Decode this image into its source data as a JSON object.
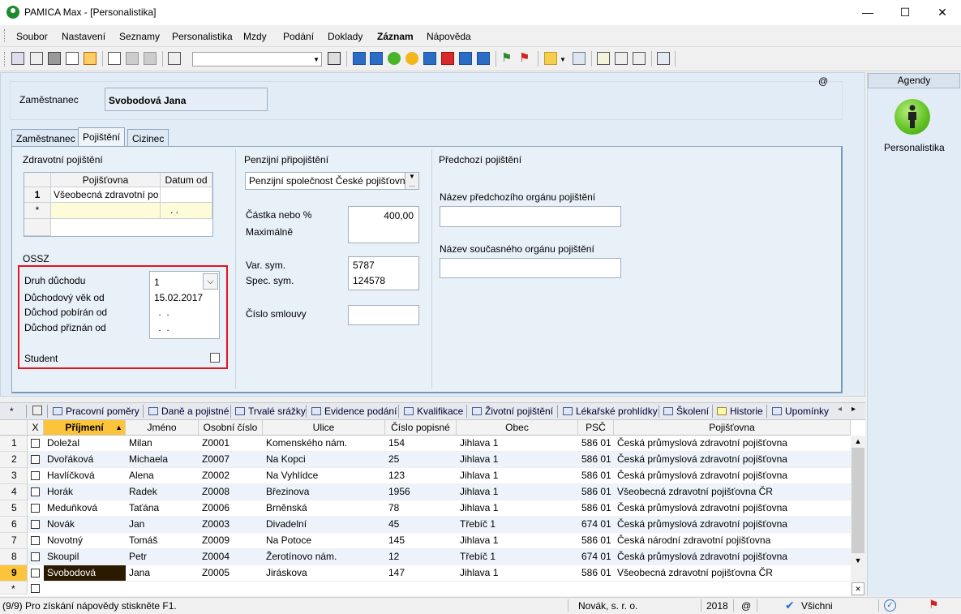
{
  "window": {
    "title": "PAMICA Max - [Personalistika]",
    "minimize": "—",
    "maximize": "☐",
    "close": "✕"
  },
  "menu": [
    {
      "label": "Soubor"
    },
    {
      "label": "Nastavení"
    },
    {
      "label": "Seznamy"
    },
    {
      "label": "Personalistika"
    },
    {
      "label": "Mzdy"
    },
    {
      "label": "Podání"
    },
    {
      "label": "Doklady"
    },
    {
      "label": "Záznam",
      "bold": true
    },
    {
      "label": "Nápověda"
    }
  ],
  "header": {
    "employee_label": "Zaměstnanec",
    "employee_value": "Svobodová Jana",
    "at_symbol": "@"
  },
  "tabs": [
    {
      "label": "Zaměstnanec",
      "active": false
    },
    {
      "label": "Pojištění",
      "active": true
    },
    {
      "label": "Cizinec",
      "active": false
    }
  ],
  "zdravotni": {
    "title": "Zdravotní pojištění",
    "col_pojistovna": "Pojišťovna",
    "col_datum": "Datum od",
    "rows": [
      {
        "num": "1",
        "pojistovna": "Všeobecná zdravotní po",
        "datum": ""
      }
    ],
    "new_row_marker": "*",
    "new_row_datum": ". ."
  },
  "ossz": {
    "title": "OSSZ",
    "druh_label": "Druh důchodu",
    "druh_value": "1",
    "vek_label": "Důchodový věk od",
    "vek_value": "15.02.2017",
    "pobiran_label": "Důchod pobírán od",
    "pobiran_value": " .  .",
    "priznan_label": "Důchod přiznán od",
    "priznan_value": " .  .",
    "student_label": "Student"
  },
  "penzijni": {
    "title": "Penzijní připojištění",
    "company": "Penzijní společnost České pojišťovn",
    "castka_label": "Částka nebo %",
    "castka_value": "400,00",
    "max_label": "Maximálně",
    "varsym_label": "Var. sym.",
    "varsym_value": "5787",
    "specsym_label": "Spec. sym.",
    "specsym_value": "124578",
    "smlouva_label": "Číslo smlouvy"
  },
  "predchozi": {
    "title": "Předchozí pojištění",
    "predchozi_label": "Název předchozího orgánu pojištění",
    "soucasny_label": "Název současného orgánu pojištění"
  },
  "agendy": {
    "title": "Agendy",
    "item": "Personalistika"
  },
  "bottom_tabs": [
    "Pracovní poměry",
    "Daně a pojistné",
    "Trvalé srážky",
    "Evidence podání",
    "Kvalifikace",
    "Životní pojištění",
    "Lékařské prohlídky",
    "Školení",
    "Historie",
    "Upomínky"
  ],
  "bottom_star": "*",
  "table": {
    "columns": [
      "X",
      "Příjmení",
      "Jméno",
      "Osobní číslo",
      "Ulice",
      "Číslo popisné",
      "Obec",
      "PSČ",
      "Pojišťovna"
    ],
    "rows": [
      [
        "1",
        "Doležal",
        "Milan",
        "Z0001",
        "Komenského nám.",
        "154",
        "Jihlava 1",
        "586 01",
        "Česká průmyslová zdravotní pojišťovna"
      ],
      [
        "2",
        "Dvořáková",
        "Michaela",
        "Z0007",
        "Na Kopci",
        "25",
        "Jihlava 1",
        "586 01",
        "Česká průmyslová zdravotní pojišťovna"
      ],
      [
        "3",
        "Havlíčková",
        "Alena",
        "Z0002",
        "Na Vyhlídce",
        "123",
        "Jihlava 1",
        "586 01",
        "Česká průmyslová zdravotní pojišťovna"
      ],
      [
        "4",
        "Horák",
        "Radek",
        "Z0008",
        "Březinova",
        "1956",
        "Jihlava 1",
        "586 01",
        "Všeobecná zdravotní pojišťovna ČR"
      ],
      [
        "5",
        "Meduňková",
        "Taťána",
        "Z0006",
        "Brněnská",
        "78",
        "Jihlava 1",
        "586 01",
        "Česká průmyslová zdravotní pojišťovna"
      ],
      [
        "6",
        "Novák",
        "Jan",
        "Z0003",
        "Divadelní",
        "45",
        "Třebíč 1",
        "674 01",
        "Česká průmyslová zdravotní pojišťovna"
      ],
      [
        "7",
        "Novotný",
        "Tomáš",
        "Z0009",
        "Na Potoce",
        "145",
        "Jihlava 1",
        "586 01",
        "Česká národní zdravotní pojišťovna"
      ],
      [
        "8",
        "Skoupil",
        "Petr",
        "Z0004",
        "Žerotínovo nám.",
        "12",
        "Třebíč 1",
        "674 01",
        "Česká průmyslová zdravotní pojišťovna"
      ],
      [
        "9",
        "Svobodová",
        "Jana",
        "Z0005",
        "Jiráskova",
        "147",
        "Jihlava 1",
        "586 01",
        "Všeobecná zdravotní pojišťovna ČR"
      ]
    ],
    "selected_row": 8,
    "new_row_marker": "*"
  },
  "status": {
    "hint": "(9/9) Pro získání nápovědy stiskněte F1.",
    "company": "Novák, s. r. o.",
    "year": "2018",
    "at": "@",
    "filter": "Všichni"
  },
  "colors": {
    "sorted_header": "#fcc43a",
    "selected_cell": "#2b1a00",
    "highlight_box": "#e3151d"
  }
}
